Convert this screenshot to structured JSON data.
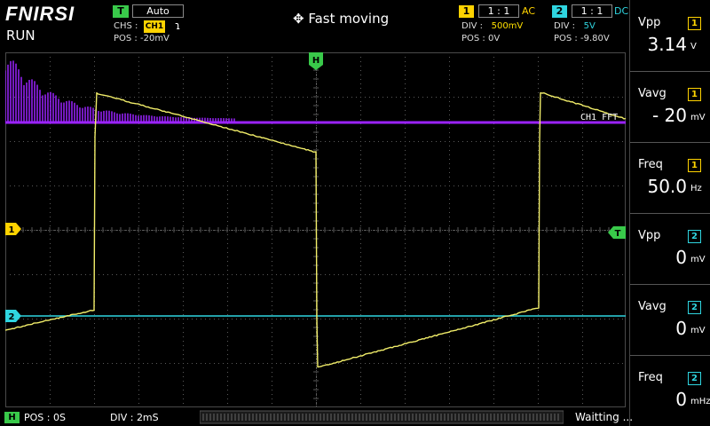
{
  "brand": "FNIRSI",
  "run_state": "RUN",
  "trigger": {
    "badge": "T",
    "mode": "Auto",
    "chs_label": "CHS :",
    "chs_value": "CH1",
    "edge_icon": "rising-edge-icon",
    "pos_label": "POS : ",
    "pos_value": "-20mV"
  },
  "move_mode": "Fast moving",
  "ch1": {
    "num": "1",
    "probe": "1 : 1",
    "coupling": "AC",
    "div_label": "DIV :",
    "div_value": "500mV",
    "pos_label": "POS : ",
    "pos_value": "0V",
    "color": "#ffd300"
  },
  "ch2": {
    "num": "2",
    "probe": "1 : 1",
    "coupling": "DC",
    "div_label": "DIV :",
    "div_value": "5V",
    "pos_label": "POS : ",
    "pos_value": "-9.80V",
    "color": "#2fd5e0"
  },
  "measurements": [
    {
      "name": "Vpp",
      "ch": "1",
      "value": "3.14",
      "unit": "V"
    },
    {
      "name": "Vavg",
      "ch": "1",
      "value": "- 20",
      "unit": "mV"
    },
    {
      "name": "Freq",
      "ch": "1",
      "value": "50.0",
      "unit": "Hz"
    },
    {
      "name": "Vpp",
      "ch": "2",
      "value": "0",
      "unit": "mV"
    },
    {
      "name": "Vavg",
      "ch": "2",
      "value": "0",
      "unit": "mV"
    },
    {
      "name": "Freq",
      "ch": "2",
      "value": "0",
      "unit": "mHz"
    }
  ],
  "plot": {
    "h_marker": "H",
    "t_marker": "T",
    "ch1_marker": "1",
    "ch2_marker": "2",
    "fft_label": "CH1 FFT"
  },
  "horizontal": {
    "badge": "H",
    "pos": "POS : 0S",
    "div": "DIV : 2mS"
  },
  "status": "Waitting ...",
  "colors": {
    "ch1": "#ffd300",
    "ch2": "#2fd5e0",
    "fft": "#9b22ff",
    "trigger": "#39c94a",
    "grid": "#5a5a5a"
  }
}
